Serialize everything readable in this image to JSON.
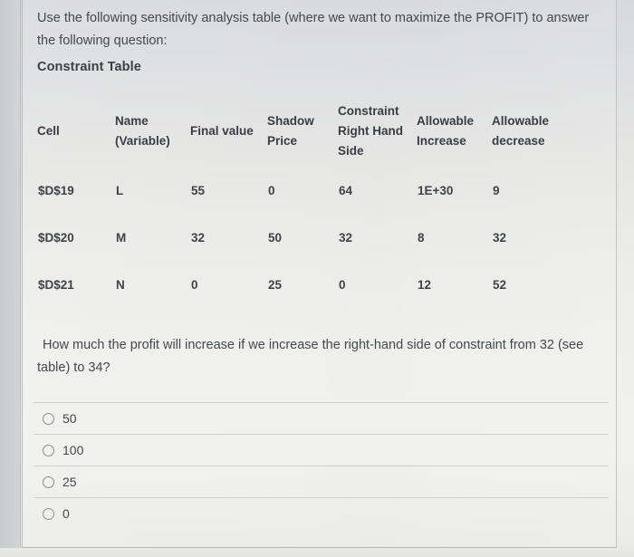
{
  "intro": {
    "text": "Use the following sensitivity analysis table (where we want to maximize the PROFIT) to answer the following question:"
  },
  "section": {
    "title": "Constraint Table"
  },
  "table": {
    "headers": [
      "Cell",
      "Name (Variable)",
      "Final value",
      "Shadow Price",
      "Constraint Right Hand Side",
      "Allowable Increase",
      "Allowable decrease"
    ],
    "headers_lines": {
      "cell": [
        "Cell"
      ],
      "name": [
        "Name",
        "(Variable)"
      ],
      "final": [
        "Final value"
      ],
      "shadow": [
        "Shadow",
        "Price"
      ],
      "rhs": [
        "Constraint",
        "Right Hand",
        "Side"
      ],
      "increase": [
        "Allowable",
        "Increase"
      ],
      "decrease": [
        "Allowable",
        "decrease"
      ]
    },
    "rows": [
      {
        "cell": "$D$19",
        "name": "L",
        "final_value": "55",
        "shadow_price": "0",
        "rhs": "64",
        "allowable_increase": "1E+30",
        "allowable_decrease": "9"
      },
      {
        "cell": "$D$20",
        "name": "M",
        "final_value": "32",
        "shadow_price": "50",
        "rhs": "32",
        "allowable_increase": "8",
        "allowable_decrease": "32"
      },
      {
        "cell": "$D$21",
        "name": "N",
        "final_value": "0",
        "shadow_price": "25",
        "rhs": "0",
        "allowable_increase": "12",
        "allowable_decrease": "52"
      }
    ]
  },
  "question": {
    "text": "How much the profit will increase if we increase the right-hand side of constraint from 32 (see table) to 34?"
  },
  "options": [
    {
      "label": "50",
      "selected": false
    },
    {
      "label": "100",
      "selected": false
    },
    {
      "label": "25",
      "selected": false
    },
    {
      "label": "0",
      "selected": false
    }
  ],
  "colors": {
    "page_background": "#ecece9",
    "text": "#45484d",
    "separator": "#cfcfcb",
    "radio_outline": "#8c8d8c"
  }
}
